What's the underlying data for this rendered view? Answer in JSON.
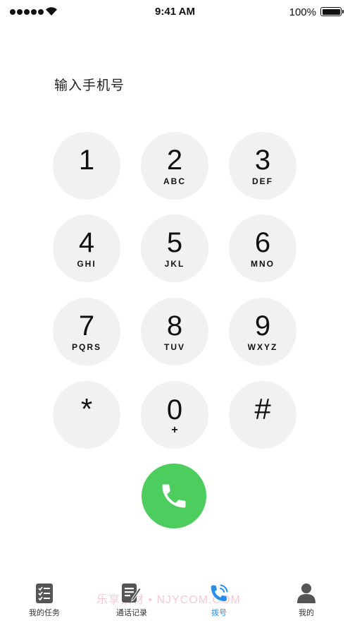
{
  "status_bar": {
    "time": "9:41 AM",
    "battery": "100%"
  },
  "prompt": "输入手机号",
  "keys": [
    {
      "digit": "1",
      "letters": ""
    },
    {
      "digit": "2",
      "letters": "ABC"
    },
    {
      "digit": "3",
      "letters": "DEF"
    },
    {
      "digit": "4",
      "letters": "GHI"
    },
    {
      "digit": "5",
      "letters": "JKL"
    },
    {
      "digit": "6",
      "letters": "MNO"
    },
    {
      "digit": "7",
      "letters": "PQRS"
    },
    {
      "digit": "8",
      "letters": "TUV"
    },
    {
      "digit": "9",
      "letters": "WXYZ"
    },
    {
      "digit": "*",
      "letters": ""
    },
    {
      "digit": "0",
      "letters": "+"
    },
    {
      "digit": "#",
      "letters": ""
    }
  ],
  "colors": {
    "call": "#4ccd5e",
    "active_tab": "#2a8ee8",
    "key_bg": "#f1f1f1"
  },
  "tabs": [
    {
      "label": "我的任务",
      "icon": "task-list-icon"
    },
    {
      "label": "通话记录",
      "icon": "call-log-icon"
    },
    {
      "label": "拨号",
      "icon": "phone-dial-icon",
      "active": true
    },
    {
      "label": "我的",
      "icon": "user-icon"
    }
  ],
  "watermark": "乐享素材 • NJYCOM.COM"
}
